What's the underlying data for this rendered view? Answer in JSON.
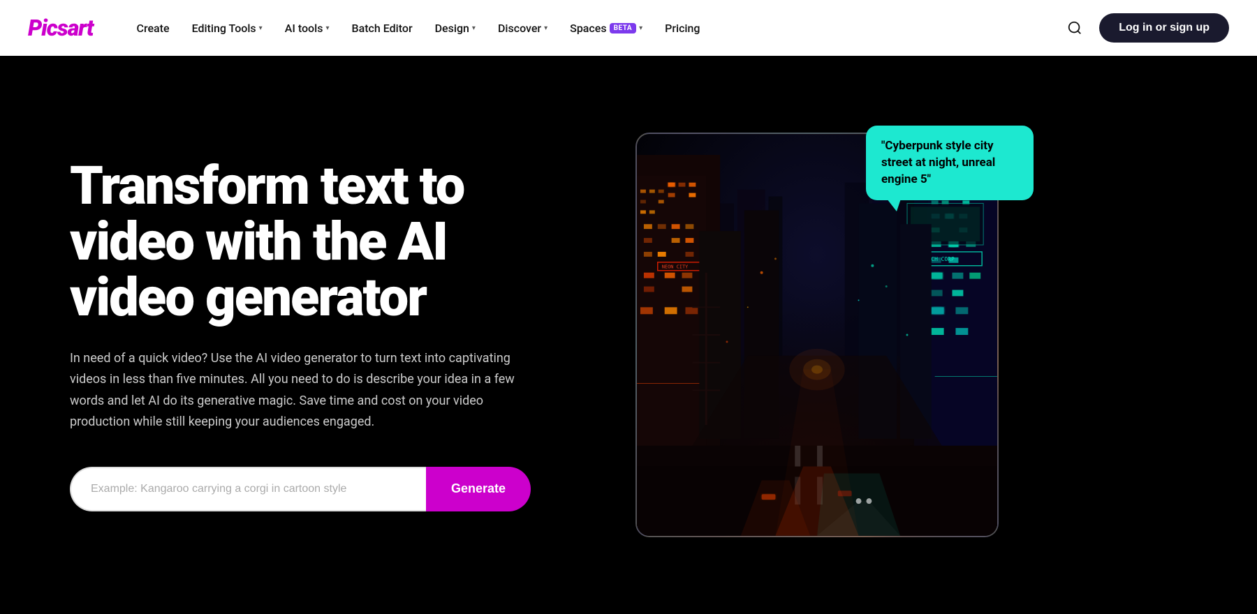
{
  "logo": {
    "text": "Picsart"
  },
  "navbar": {
    "links": [
      {
        "label": "Create",
        "hasDropdown": false
      },
      {
        "label": "Editing Tools",
        "hasDropdown": true
      },
      {
        "label": "AI tools",
        "hasDropdown": true
      },
      {
        "label": "Batch Editor",
        "hasDropdown": false
      },
      {
        "label": "Design",
        "hasDropdown": true
      },
      {
        "label": "Discover",
        "hasDropdown": true
      },
      {
        "label": "Spaces",
        "hasBeta": true,
        "hasDropdown": true
      },
      {
        "label": "Pricing",
        "hasDropdown": false
      }
    ],
    "login_label": "Log in or sign up"
  },
  "hero": {
    "title": "Transform text to video with the AI video generator",
    "subtitle": "In need of a quick video? Use the AI video generator to turn text into captivating videos in less than five minutes. All you need to do is describe your idea in a few words and let AI do its generative magic. Save time and cost on your video production while still keeping your audiences engaged.",
    "input_placeholder": "Example: Kangaroo carrying a corgi in cartoon style",
    "generate_label": "Generate",
    "speech_bubble_text": "\"Cyberpunk style city street at night, unreal engine 5\""
  }
}
